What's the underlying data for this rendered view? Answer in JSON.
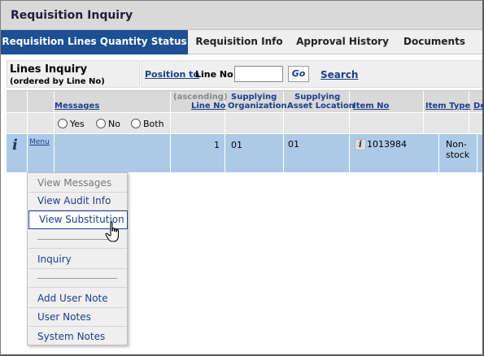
{
  "window": {
    "title": "Requisition Inquiry"
  },
  "tabs": [
    {
      "label": "Requisition Lines Quantity Status",
      "active": true
    },
    {
      "label": "Requisition Info",
      "active": false
    },
    {
      "label": "Approval History",
      "active": false
    },
    {
      "label": "Documents",
      "active": false
    }
  ],
  "toolbar": {
    "heading": "Lines Inquiry",
    "subheading": "(ordered by Line No)",
    "position_link": "Position to",
    "position_label": "Line No",
    "position_value": "",
    "go_label": "Go",
    "search_label": "Search"
  },
  "grid": {
    "headers": {
      "messages": "Messages",
      "line_no_hint": "(ascending)",
      "line_no": "Line No",
      "supplying_org_1": "Supplying",
      "supplying_org_2": "Organization",
      "supplying_asset_1": "Supplying",
      "supplying_asset_2": "Asset Location",
      "item_no": "Item No",
      "item_type": "Item Type",
      "description_partial": "De"
    },
    "filter": {
      "options": [
        "Yes",
        "No",
        "Both"
      ]
    },
    "rows": [
      {
        "menu_label": "Menu",
        "line_no": "1",
        "supplying_org": "01",
        "supplying_asset": "01",
        "item_no": "1013984",
        "item_type_line1": "Non-",
        "item_type_line2": "stock"
      }
    ]
  },
  "context_menu": {
    "items": [
      {
        "label": "View Messages",
        "enabled": false
      },
      {
        "label": "View Audit Info",
        "enabled": true
      },
      {
        "label": "View Substitution",
        "enabled": true,
        "highlighted": true
      },
      {
        "label": "Inquiry",
        "enabled": true
      },
      {
        "label": "Add User Note",
        "enabled": true
      },
      {
        "label": "User Notes",
        "enabled": true
      },
      {
        "label": "System Notes",
        "enabled": true
      }
    ]
  },
  "colors": {
    "active_tab": "#1c4f93",
    "row_selected": "#adc9e8",
    "link": "#1a3f8b"
  },
  "icons": {
    "info": "info-icon",
    "cursor": "hand-pointer-icon"
  }
}
